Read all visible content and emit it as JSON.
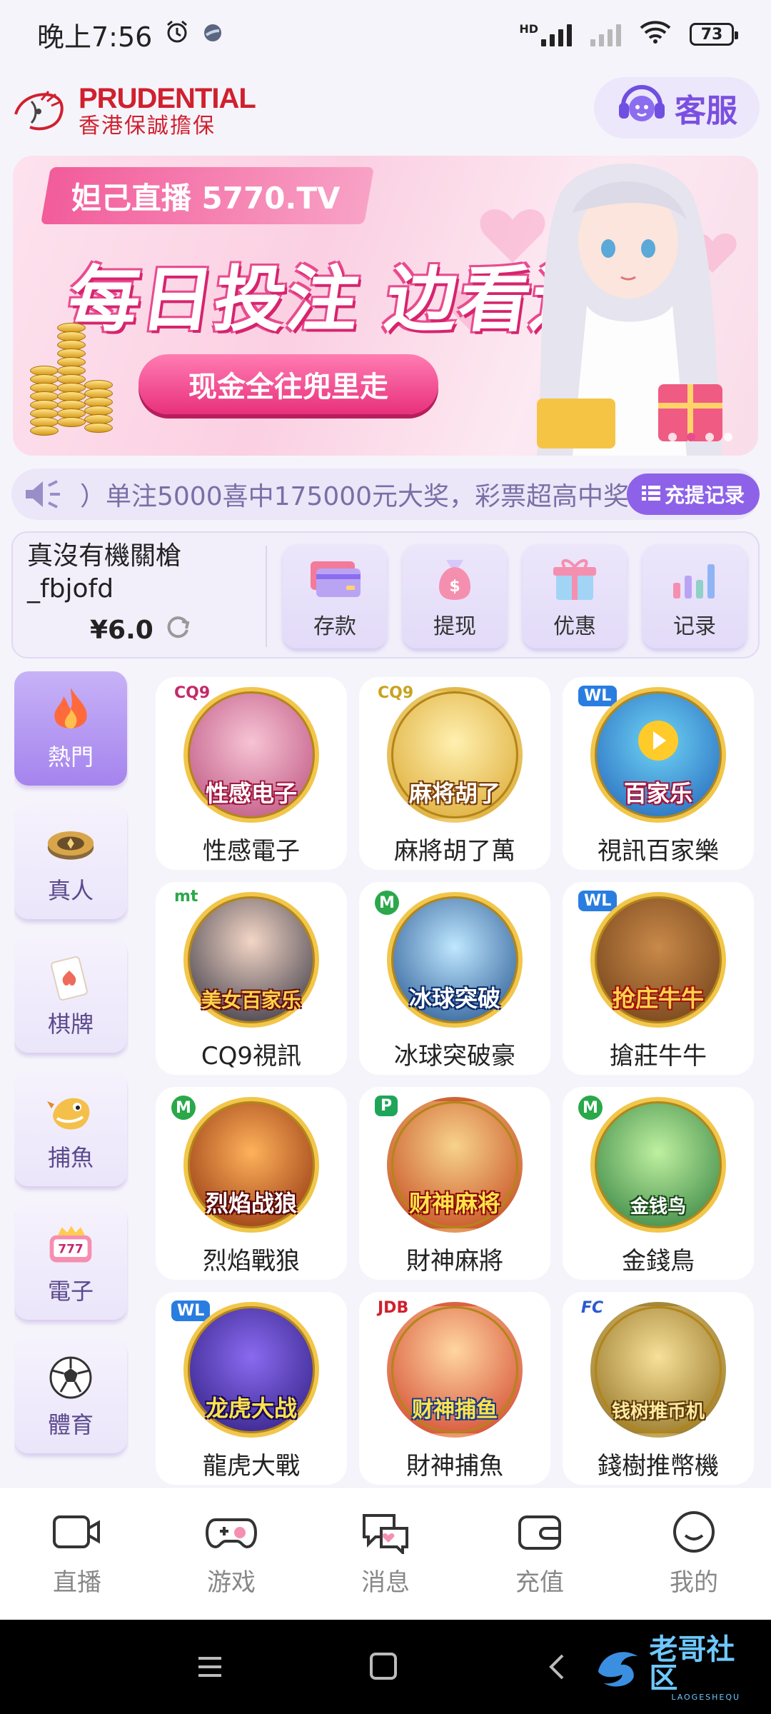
{
  "status_bar": {
    "time": "晚上7:56",
    "network": "HD",
    "battery": "73"
  },
  "header": {
    "logo_brand": "PRUDENTIAL",
    "logo_sub": "香港保誠擔保",
    "customer_service_label": "客服"
  },
  "banner": {
    "tag": "妲己直播 5770.TV",
    "heading": "每日投注 边看边投",
    "cta": "现金全往兜里走"
  },
  "marquee": {
    "text": "）单注5000喜中175000元大奖，彩票超高中奖",
    "record_button": "充提记录"
  },
  "account": {
    "username_line1": "真沒有機關槍",
    "username_line2": "_fbjofd",
    "balance": "¥6.0",
    "actions": [
      {
        "label": "存款"
      },
      {
        "label": "提现"
      },
      {
        "label": "优惠"
      },
      {
        "label": "记录"
      }
    ]
  },
  "sidebar": {
    "items": [
      {
        "label": "熱門"
      },
      {
        "label": "真人"
      },
      {
        "label": "棋牌"
      },
      {
        "label": "捕魚"
      },
      {
        "label": "電子"
      },
      {
        "label": "體育"
      }
    ]
  },
  "games": [
    {
      "name": "性感電子",
      "provider": "CQ9",
      "art_text": "性感电子"
    },
    {
      "name": "麻將胡了萬",
      "provider": "CQ9",
      "art_text": "麻将胡了"
    },
    {
      "name": "視訊百家樂",
      "provider": "WL",
      "art_text": "百家乐"
    },
    {
      "name": "CQ9視訊",
      "provider": "mt",
      "art_text": "美女百家乐"
    },
    {
      "name": "冰球突破豪",
      "provider": "M",
      "art_text": "冰球突破"
    },
    {
      "name": "搶莊牛牛",
      "provider": "WL",
      "art_text": "抢庄牛牛"
    },
    {
      "name": "烈焰戰狼",
      "provider": "M",
      "art_text": "烈焰战狼"
    },
    {
      "name": "財神麻將",
      "provider": "P",
      "art_text": "财神麻将"
    },
    {
      "name": "金錢鳥",
      "provider": "M",
      "art_text": "金钱鸟"
    },
    {
      "name": "龍虎大戰",
      "provider": "WL",
      "art_text": "龙虎大战"
    },
    {
      "name": "財神捕魚",
      "provider": "JDB",
      "art_text": "财神捕鱼"
    },
    {
      "name": "錢樹推幣機",
      "provider": "FC",
      "art_text": "钱树推币机"
    }
  ],
  "bottom_nav": {
    "items": [
      {
        "label": "直播"
      },
      {
        "label": "游戏"
      },
      {
        "label": "消息"
      },
      {
        "label": "充值"
      },
      {
        "label": "我的"
      }
    ]
  },
  "watermark": {
    "text": "老哥社区",
    "sub": "LAOGESHEQU"
  },
  "colors": {
    "accent": "#8d62e8",
    "brand_red": "#d0202e",
    "pink": "#e94b8f"
  }
}
